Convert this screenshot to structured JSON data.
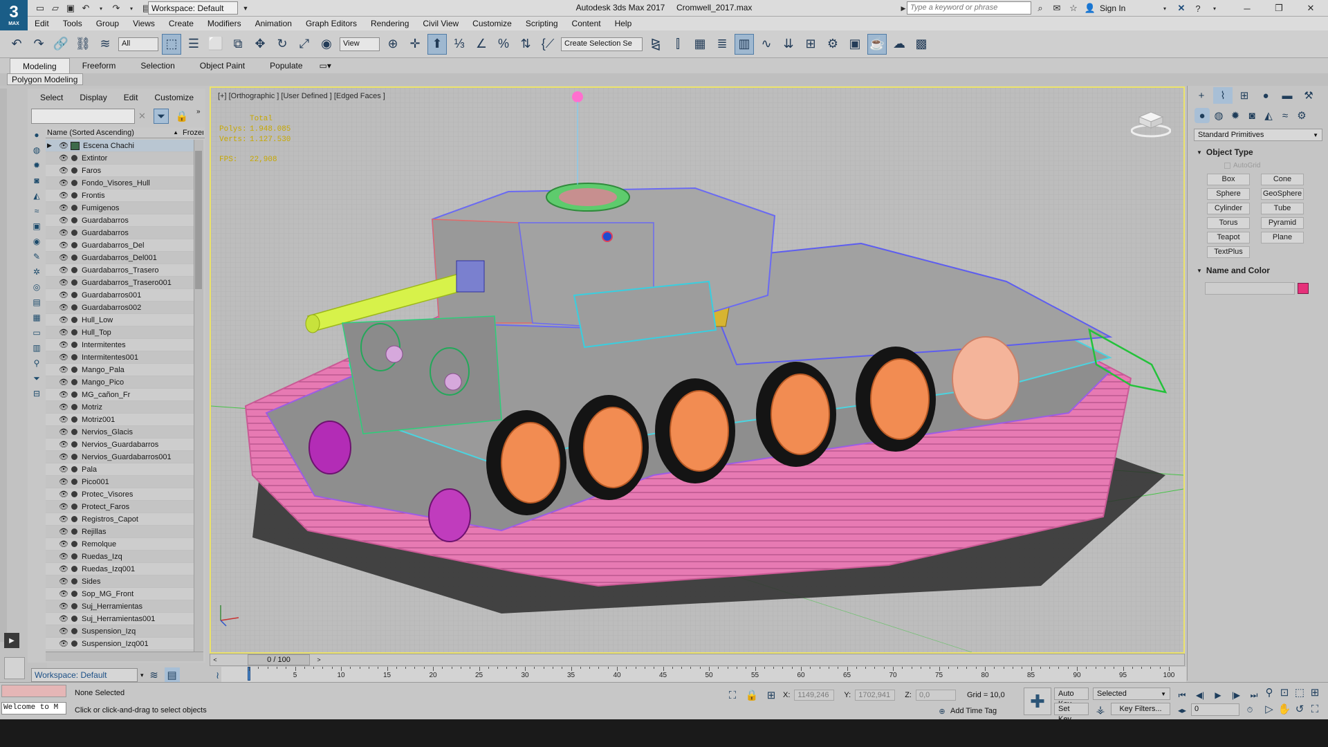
{
  "window": {
    "title": "Autodesk 3ds Max 2017",
    "file": "Cromwell_2017.max",
    "workspace": "Workspace: Default",
    "logo": "3",
    "logo_sub": "MAX",
    "search_placeholder": "Type a keyword or phrase",
    "sign_in": "Sign In"
  },
  "menu": [
    "Edit",
    "Tools",
    "Group",
    "Views",
    "Create",
    "Modifiers",
    "Animation",
    "Graph Editors",
    "Rendering",
    "Civil View",
    "Customize",
    "Scripting",
    "Content",
    "Help"
  ],
  "toolbar": {
    "filter": "All",
    "ref_coord": "View",
    "selection_set": "Create Selection Se"
  },
  "ribbon": {
    "tabs": [
      "Modeling",
      "Freeform",
      "Selection",
      "Object Paint",
      "Populate"
    ],
    "active": "Modeling",
    "panel": "Polygon Modeling"
  },
  "explorer": {
    "menu": [
      "Select",
      "Display",
      "Edit",
      "Customize"
    ],
    "col_name": "Name (Sorted Ascending)",
    "col_frozen": "Frozen",
    "items": [
      "Escena Chachi",
      "Extintor",
      "Faros",
      "Fondo_Visores_Hull",
      "Frontis",
      "Fumigenos",
      "Guardabarros",
      "Guardabarros",
      "Guardabarros_Del",
      "Guardabarros_Del001",
      "Guardabarros_Trasero",
      "Guardabarros_Trasero001",
      "Guardabarros001",
      "Guardabarros002",
      "Hull_Low",
      "Hull_Top",
      "Intermitentes",
      "Intermitentes001",
      "Mango_Pala",
      "Mango_Pico",
      "MG_cañon_Fr",
      "Motriz",
      "Motriz001",
      "Nervios_Glacis",
      "Nervios_Guardabarros",
      "Nervios_Guardabarros001",
      "Pala",
      "Pico001",
      "Protec_Visores",
      "Protect_Faros",
      "Registros_Capot",
      "Rejillas",
      "Remolque",
      "Ruedas_Izq",
      "Ruedas_Izq001",
      "Sides",
      "Sop_MG_Front",
      "Suj_Herramientas",
      "Suj_Herramientas001",
      "Suspension_Izq",
      "Suspension_Izq001"
    ],
    "workspace": "Workspace: Default"
  },
  "viewport": {
    "label": "[+] [Orthographic ] [User Defined ] [Edged Faces ]",
    "stats_title": "Total",
    "polys_label": "Polys:",
    "polys": "1.948.085",
    "verts_label": "Verts:",
    "verts": "1.127.530",
    "fps_label": "FPS:",
    "fps": "22,908"
  },
  "timeline": {
    "frame": "0 / 100",
    "ticks": [
      "5",
      "10",
      "15",
      "20",
      "25",
      "30",
      "35",
      "40",
      "45",
      "50",
      "55",
      "60",
      "65",
      "70",
      "75",
      "80",
      "85",
      "90",
      "95",
      "100"
    ]
  },
  "command_panel": {
    "dropdown": "Standard Primitives",
    "object_type": "Object Type",
    "autogrid": "AutoGrid",
    "primitives": [
      "Box",
      "Cone",
      "Sphere",
      "GeoSphere",
      "Cylinder",
      "Tube",
      "Torus",
      "Pyramid",
      "Teapot",
      "Plane",
      "TextPlus"
    ],
    "name_and_color": "Name and Color",
    "swatch_color": "#e6317a"
  },
  "status": {
    "selected": "None Selected",
    "prompt": "Click or click-and-drag to select objects",
    "welcome": "Welcome to M",
    "x_label": "X:",
    "x": "1149,246",
    "y_label": "Y:",
    "y": "1702,941",
    "z_label": "Z:",
    "z": "0,0",
    "grid": "Grid = 10,0",
    "add_time_tag": "Add Time Tag",
    "auto_key": "Auto Key",
    "set_key": "Set Key",
    "key_mode": "Selected",
    "key_filters": "Key Filters...",
    "frame_field": "0"
  }
}
